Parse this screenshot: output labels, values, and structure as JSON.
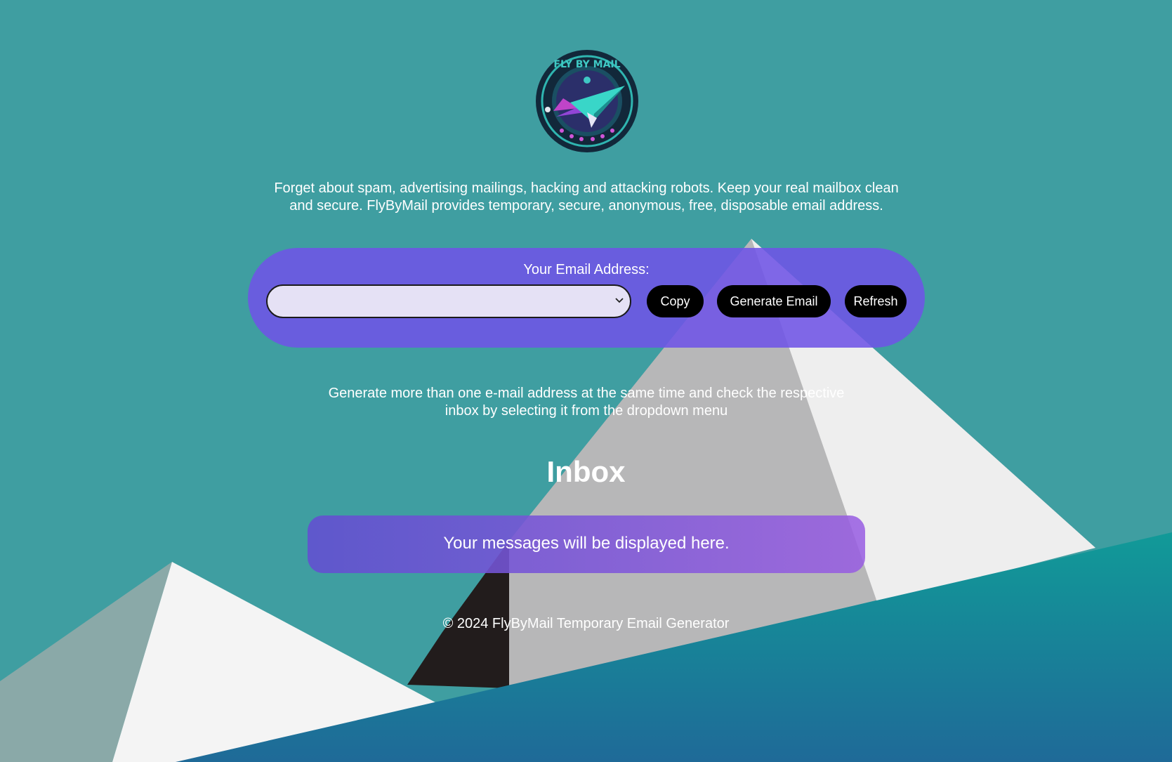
{
  "brand": {
    "logo_text": "FLY BY MAIL"
  },
  "intro": {
    "line1": "Forget about spam, advertising mailings, hacking and attacking robots. Keep your real mailbox clean",
    "line2": "and secure. FlyByMail provides temporary, secure, anonymous, free, disposable email address."
  },
  "email_panel": {
    "label": "Your Email Address:",
    "selected_value": "",
    "copy_label": "Copy",
    "generate_label": "Generate Email",
    "refresh_label": "Refresh"
  },
  "hint": {
    "line1": "Generate more than one e-mail address at the same time and check the respective",
    "line2": "inbox by selecting it from the dropdown menu"
  },
  "inbox": {
    "title": "Inbox",
    "empty_message": "Your messages will be displayed here."
  },
  "footer": {
    "text": "© 2024 FlyByMail Temporary Email Generator"
  },
  "colors": {
    "background_teal": "#3f9ea1",
    "panel_purple": "#7054e6",
    "button_black": "#000000",
    "select_fill": "#e5e1f5",
    "text_white": "#ffffff"
  },
  "icons": {
    "select_chevron": "chevron-down-icon",
    "logo": "paper-plane-logo"
  }
}
